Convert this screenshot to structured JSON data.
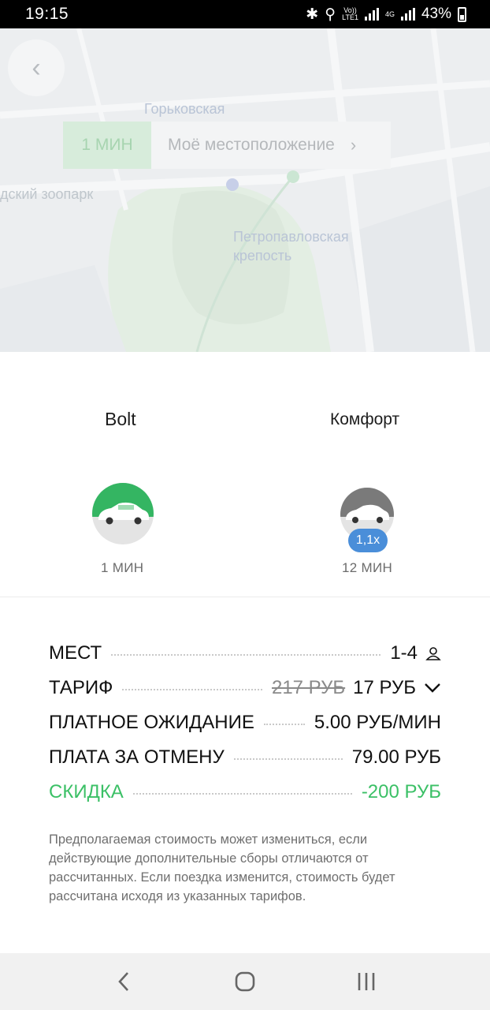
{
  "status": {
    "time": "19:15",
    "volte": "Vo))",
    "lte": "LTE1",
    "net": "4G",
    "battery": "43%"
  },
  "map": {
    "pickup_eta": "1 МИН",
    "pickup_address": "Моё местоположение",
    "labels": {
      "station": "Горьковская",
      "zoo": "дский зоопарк",
      "fortress_1": "Петропавловская",
      "fortress_2": "крепость"
    }
  },
  "categories": [
    {
      "name": "Bolt",
      "eta": "1 МИН",
      "color": "#34b562"
    },
    {
      "name": "Комфорт",
      "eta": "12 МИН",
      "surge": "1,1x",
      "color": "#7a7a7a"
    }
  ],
  "details": {
    "seats": {
      "label": "МЕСТ",
      "value": "1-4"
    },
    "tariff": {
      "label": "ТАРИФ",
      "old_price": "217 РУБ",
      "price": "17 РУБ"
    },
    "waiting": {
      "label": "ПЛАТНОЕ ОЖИДАНИЕ",
      "value": "5.00 РУБ/МИН"
    },
    "cancel": {
      "label": "ПЛАТА ЗА ОТМЕНУ",
      "value": "79.00 РУБ"
    },
    "discount": {
      "label": "СКИДКА",
      "value": "-200 РУБ"
    }
  },
  "disclaimer": "Предполагаемая стоимость может измениться, если действующие дополнительные сборы отличаются от рассчитанных. Если поездка изменится, стоимость будет рассчитана исходя из указанных тарифов.",
  "colors": {
    "accent_green": "#3bc066",
    "surge_blue": "#4a8ed9"
  }
}
